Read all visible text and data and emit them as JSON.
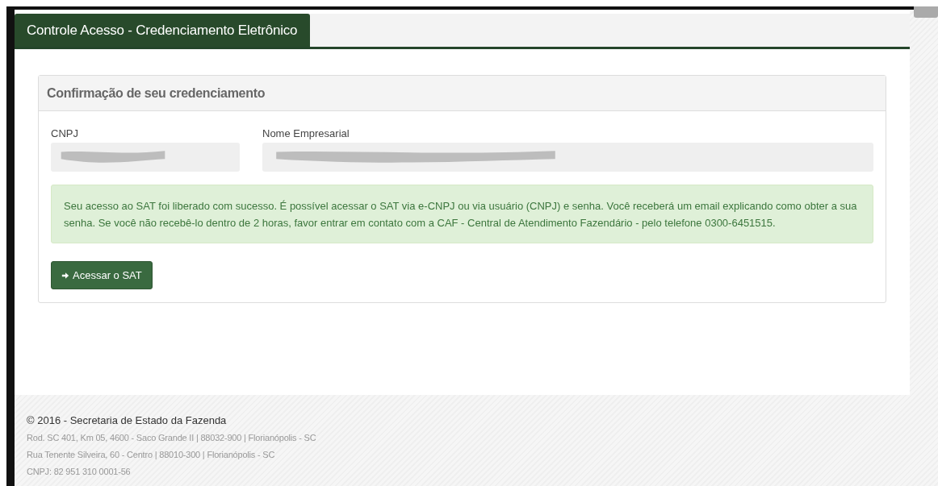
{
  "header": {
    "title": "Controle Acesso - Credenciamento Eletrônico"
  },
  "panel": {
    "heading": "Confirmação de seu credenciamento",
    "fields": [
      {
        "label": "CNPJ",
        "redacted": true
      },
      {
        "label": "Nome Empresarial",
        "redacted": true
      }
    ],
    "alert": {
      "text": "Seu acesso ao SAT foi liberado com sucesso. É possível acessar o SAT via e-CNPJ ou via usuário (CNPJ) e senha. Você receberá um email explicando como obter a sua senha. Se você não recebê-lo dentro de 2 horas, favor entrar em contato com a CAF - Central de Atendimento Fazendário - pelo telefone 0300-6451515."
    },
    "button": {
      "label": "Acessar o SAT"
    }
  },
  "footer": {
    "copyright": "© 2016 - Secretaria de Estado da Fazenda",
    "lines": [
      "Rod. SC 401, Km 05, 4600 - Saco Grande II | 88032-900 | Florianópolis - SC",
      "Rua Tenente Silveira, 60 - Centro | 88010-300 | Florianópolis - SC",
      "CNPJ: 82 951 310 0001-56"
    ]
  }
}
